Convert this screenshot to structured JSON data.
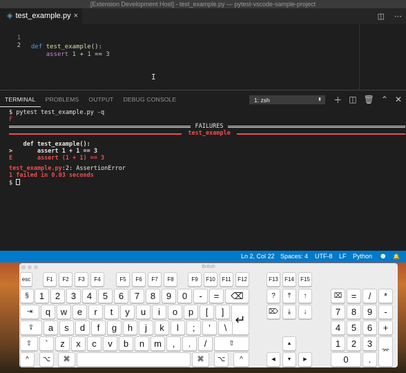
{
  "window": {
    "title": "[Extension Development Host] - test_example.py — pytest-vscode-sample-project"
  },
  "editor_tab": {
    "label": "test_example.py",
    "close": "×"
  },
  "editor": {
    "lines": [
      {
        "num": "1",
        "kw": "def",
        "fn": "test_example",
        "rest": "():"
      },
      {
        "num": "2",
        "indent": "    ",
        "kw": "assert",
        "a": "1",
        "op1": " + ",
        "b": "1",
        "op2": " == ",
        "c": "3"
      }
    ]
  },
  "panel": {
    "tabs": [
      "TERMINAL",
      "PROBLEMS",
      "OUTPUT",
      "DEBUG CONSOLE"
    ],
    "terminal_select": "1: zsh"
  },
  "terminal": {
    "cmd": "$ pytest test_example.py -q",
    "result": "F",
    "failures_header": " FAILURES ",
    "test_header": " test_example ",
    "def_line": "    def test_example():",
    "arrow_marker": ">",
    "arrow_code": "       assert 1 + 1 == 3",
    "err_marker": "E",
    "err_code": "       assert (1 + 1) == 3",
    "loc_file": "test_example.py",
    "loc_rest": ":2: AssertionError",
    "summary": "1 failed in 0.03 seconds",
    "prompt": "$ "
  },
  "statusbar": {
    "position": "Ln 2, Col 22",
    "spaces": "Spaces: 4",
    "encoding": "UTF-8",
    "eol": "LF",
    "language": "Python",
    "smiley": "☻",
    "bell": "🔔"
  },
  "keyboard": {
    "title": "British",
    "esc": "esc",
    "f1_4": [
      "F1",
      "F2",
      "F3",
      "F4"
    ],
    "f5_8": [
      "F5",
      "F6",
      "F7",
      "F8"
    ],
    "f9_12": [
      "F9",
      "F10",
      "F11",
      "F12"
    ],
    "f13_15": [
      "F13",
      "F14",
      "F15"
    ],
    "row_num": [
      "§",
      "1",
      "2",
      "3",
      "4",
      "5",
      "6",
      "7",
      "8",
      "9",
      "0",
      "-",
      "="
    ],
    "delete": "⌫",
    "row_q": [
      "q",
      "w",
      "e",
      "r",
      "t",
      "y",
      "u",
      "i",
      "o",
      "p",
      "[",
      "]"
    ],
    "tab": "⇥",
    "return": "↵",
    "row_a": [
      "a",
      "s",
      "d",
      "f",
      "g",
      "h",
      "j",
      "k",
      "l",
      ";",
      "'",
      "\\"
    ],
    "caps": "⇪",
    "row_z": [
      "`",
      "z",
      "x",
      "c",
      "v",
      "b",
      "n",
      "m",
      ",",
      ".",
      "/"
    ],
    "shift": "⇧",
    "bottom": {
      "ctrl": "^",
      "opt": "⌥",
      "cmd": "⌘"
    },
    "nav": {
      "help": "?",
      "home": "⤒",
      "pgup": "↑",
      "fdel": "⌦",
      "end": "⤓",
      "pgdn": "↓",
      "up": "▲",
      "left": "◀",
      "down": "▼",
      "right": "▶"
    },
    "numpad": {
      "row1": [
        "⌧",
        "=",
        "/",
        "*"
      ],
      "row2": [
        "7",
        "8",
        "9",
        "-"
      ],
      "row3": [
        "4",
        "5",
        "6",
        "+"
      ],
      "row4": [
        "1",
        "2",
        "3"
      ],
      "row5": [
        "0",
        "."
      ],
      "enter": "⌤"
    }
  }
}
